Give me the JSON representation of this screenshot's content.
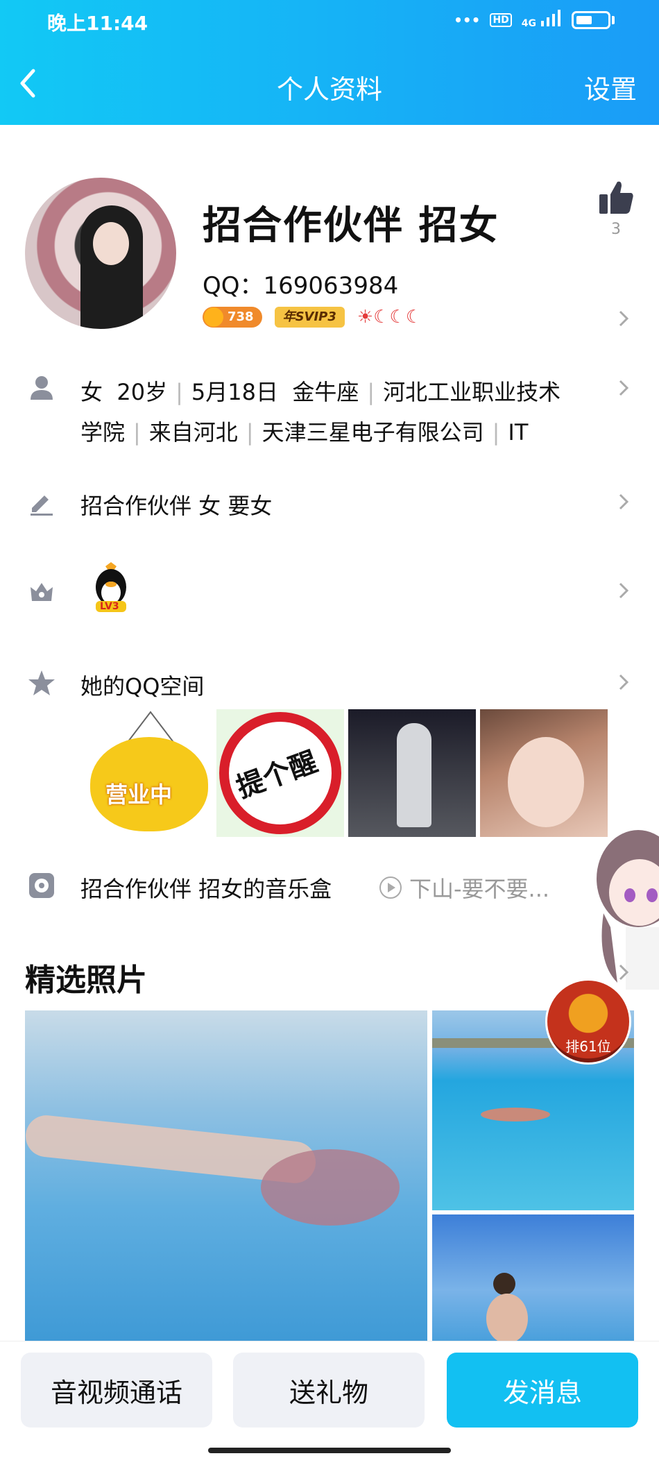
{
  "status_bar": {
    "time": "晚上11:44",
    "signal": "4G",
    "hd": "HD"
  },
  "nav": {
    "title": "个人资料",
    "settings": "设置"
  },
  "profile": {
    "nickname": "招合作伙伴  招女",
    "qq_label": "QQ：169063984",
    "coin_badge": "738",
    "svip_badge": "年SVIP3",
    "level_icons": "☀☾☾☾",
    "like_count": "3"
  },
  "info": {
    "line1": [
      "女",
      "20岁",
      "5月18日",
      "金牛座",
      "河北工业职业技术"
    ],
    "line2": [
      "学院",
      "来自河北",
      "天津三星电子有限公司",
      "IT"
    ]
  },
  "signature": "招合作伙伴  女  要女",
  "pet": {
    "level_label": "LV3"
  },
  "qzone": {
    "label": "她的QQ空间",
    "photo1_text": "营业中",
    "photo2_text": "提个醒"
  },
  "music": {
    "label": "招合作伙伴  招女的音乐盒",
    "song": "下山-要不要..."
  },
  "featured": {
    "title": "精选照片",
    "rank_label": "排61位"
  },
  "actions": {
    "call": "音视频通话",
    "gift": "送礼物",
    "message": "发消息"
  },
  "colors": {
    "header_start": "#12c9f5",
    "header_end": "#1a9cf7",
    "primary_button": "#12c0f2"
  }
}
